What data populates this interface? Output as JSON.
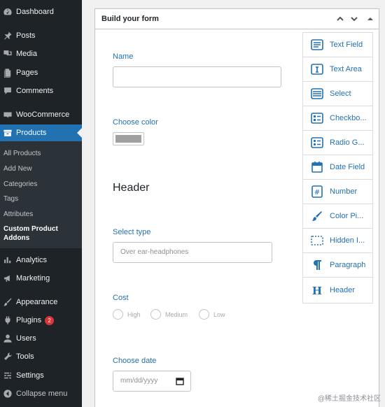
{
  "sidebar": {
    "menu": [
      {
        "label": "Dashboard",
        "icon": "dashboard-icon"
      },
      {
        "label": "Posts",
        "icon": "pin-icon"
      },
      {
        "label": "Media",
        "icon": "media-icon"
      },
      {
        "label": "Pages",
        "icon": "pages-icon"
      },
      {
        "label": "Comments",
        "icon": "comment-icon"
      },
      {
        "label": "WooCommerce",
        "icon": "woocommerce-icon"
      },
      {
        "label": "Products",
        "icon": "products-icon"
      },
      {
        "label": "Analytics",
        "icon": "analytics-icon"
      },
      {
        "label": "Marketing",
        "icon": "megaphone-icon"
      },
      {
        "label": "Appearance",
        "icon": "brush-icon"
      },
      {
        "label": "Plugins",
        "icon": "plugin-icon",
        "badge": "2"
      },
      {
        "label": "Users",
        "icon": "users-icon"
      },
      {
        "label": "Tools",
        "icon": "wrench-icon"
      },
      {
        "label": "Settings",
        "icon": "settings-icon"
      },
      {
        "label": "Collapse menu",
        "icon": "collapse-icon"
      }
    ],
    "submenu": [
      "All Products",
      "Add New",
      "Categories",
      "Tags",
      "Attributes",
      "Custom Product Addons"
    ]
  },
  "panel": {
    "title": "Build your form",
    "fields": {
      "name_label": "Name",
      "color_label": "Choose color",
      "header_text": "Header",
      "select_label": "Select type",
      "select_placeholder": "Over ear-headphones",
      "cost_label": "Cost",
      "cost_options": [
        "High",
        "Medium",
        "Low"
      ],
      "date_label": "Choose date",
      "date_placeholder": "mm/dd/yyyy"
    }
  },
  "palette": [
    {
      "label": "Text Field",
      "icon": "text-field-icon"
    },
    {
      "label": "Text Area",
      "icon": "text-area-icon"
    },
    {
      "label": "Select",
      "icon": "select-icon"
    },
    {
      "label": "Checkbo...",
      "icon": "checkbox-icon"
    },
    {
      "label": "Radio G...",
      "icon": "radio-group-icon"
    },
    {
      "label": "Date Field",
      "icon": "calendar-icon"
    },
    {
      "label": "Number",
      "icon": "number-icon"
    },
    {
      "label": "Color Pi...",
      "icon": "color-picker-icon"
    },
    {
      "label": "Hidden I...",
      "icon": "hidden-input-icon"
    },
    {
      "label": "Paragraph",
      "icon": "paragraph-icon"
    },
    {
      "label": "Header",
      "icon": "header-icon"
    }
  ],
  "watermark": "@稀土掘金技术社区",
  "colors": {
    "accent": "#2271b1",
    "sidebar": "#1d2327",
    "badge": "#d63638"
  }
}
